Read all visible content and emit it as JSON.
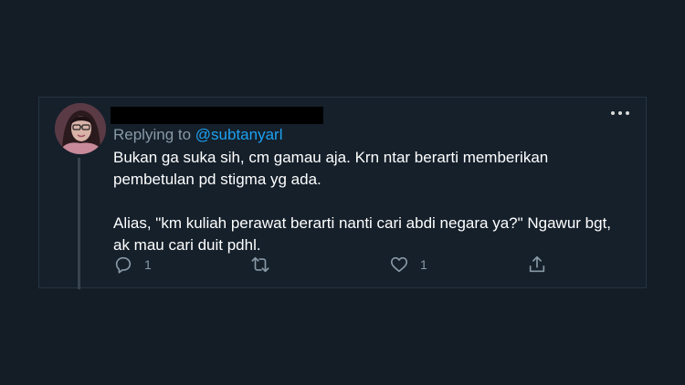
{
  "tweet": {
    "replying_prefix": "Replying to ",
    "replying_handle": "@subtanyarl",
    "paragraph1": "Bukan ga suka sih, cm gamau aja. Krn ntar berarti memberikan pembetulan pd stigma yg ada.",
    "paragraph2": "Alias, \"km kuliah perawat berarti nanti cari abdi negara ya?\" Ngawur bgt, ak mau cari duit pdhl."
  },
  "actions": {
    "reply_count": "1",
    "retweet_count": "",
    "like_count": "1"
  },
  "icons": {
    "reply": "reply-icon",
    "retweet": "retweet-icon",
    "like": "heart-icon",
    "share": "share-icon",
    "more": "more-icon"
  },
  "colors": {
    "background": "#141d26",
    "card": "#15202b",
    "text": "#ffffff",
    "muted": "#8899a6",
    "accent": "#1da1f2"
  }
}
